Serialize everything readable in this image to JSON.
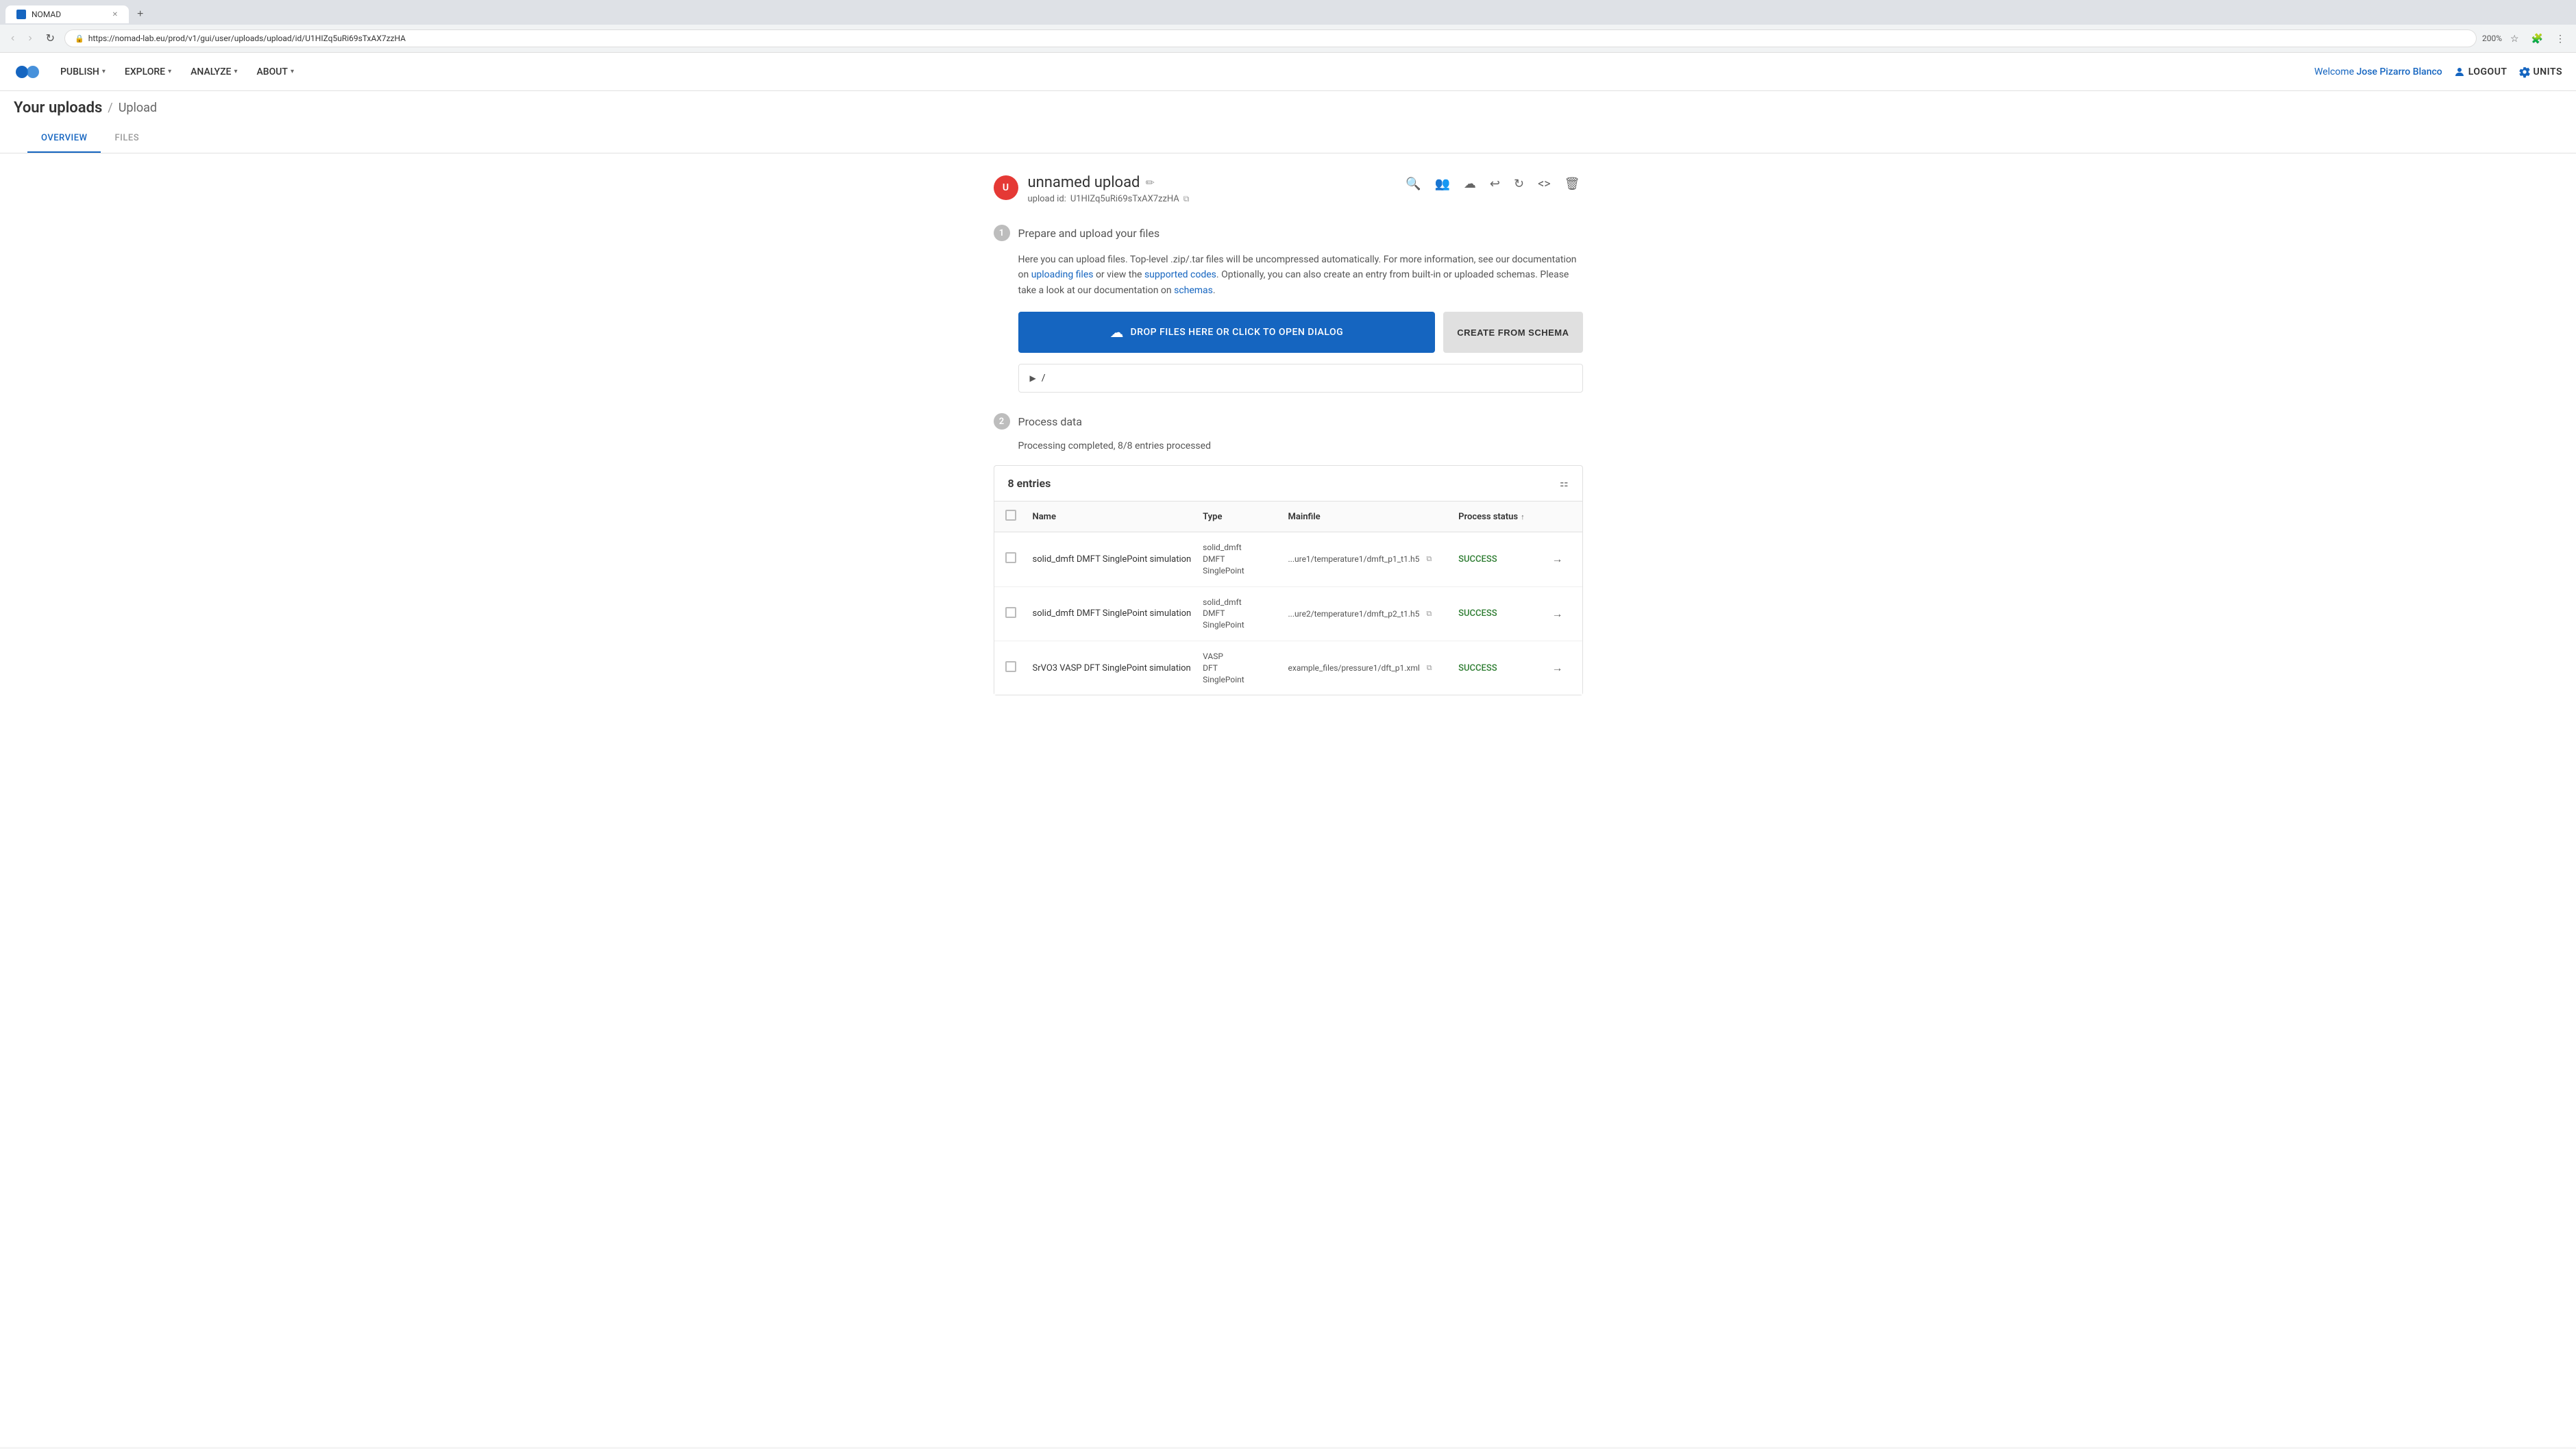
{
  "browser": {
    "tab_title": "NOMAD",
    "tab_favicon": "N",
    "url": "https://nomad-lab.eu/prod/v1/gui/user/uploads/upload/id/U1HIZq5uRi69sTxAX7zzHA",
    "zoom": "200%",
    "back_disabled": true,
    "forward_disabled": true
  },
  "nav": {
    "logo_alt": "NOMAD Logo",
    "items": [
      {
        "label": "PUBLISH",
        "has_chevron": true
      },
      {
        "label": "EXPLORE",
        "has_chevron": true
      },
      {
        "label": "ANALYZE",
        "has_chevron": true
      },
      {
        "label": "ABOUT",
        "has_chevron": true
      }
    ],
    "welcome_prefix": "Welcome ",
    "user_name": "Jose Pizarro Blanco",
    "logout_label": "LOGOUT",
    "units_label": "UNITS"
  },
  "breadcrumb": {
    "parent": "Your uploads",
    "separator": "/",
    "current": "Upload"
  },
  "tabs": [
    {
      "label": "OVERVIEW",
      "active": true
    },
    {
      "label": "FILES",
      "active": false
    }
  ],
  "upload": {
    "avatar_initials": "U",
    "title": "unnamed upload",
    "edit_icon": "✏",
    "id_label": "upload id:",
    "id_value": "U1HIZq5uRi69sTxAX7zzHA",
    "copy_icon": "⧉",
    "actions": [
      {
        "name": "search",
        "icon": "🔍"
      },
      {
        "name": "members",
        "icon": "👥"
      },
      {
        "name": "upload-cloud",
        "icon": "☁"
      },
      {
        "name": "undo",
        "icon": "↩"
      },
      {
        "name": "redo",
        "icon": "↻"
      },
      {
        "name": "code",
        "icon": "⟨⟩"
      },
      {
        "name": "delete",
        "icon": "🗑"
      }
    ]
  },
  "section1": {
    "number": "1",
    "title": "Prepare and upload your files",
    "info_text_1": "Here you can upload files. Top-level .zip/.tar files will be uncompressed automatically. For more information, see our documentation on ",
    "link1_text": "uploading files",
    "info_text_2": " or view the ",
    "link2_text": "supported codes",
    "info_text_3": ". Optionally, you can also create an entry from built-in or uploaded schemas. Please take a look at our documentation on ",
    "link3_text": "schemas",
    "info_text_4": ".",
    "drop_zone_text": "DROP FILES HERE OR CLICK TO OPEN DIALOG",
    "drop_zone_icon": "☁",
    "schema_btn_label": "CREATE FROM SCHEMA",
    "file_path": "/"
  },
  "section2": {
    "number": "2",
    "title": "Process data",
    "status_text": "Processing completed, 8/8 entries processed",
    "entries_label": "8 entries",
    "table": {
      "columns": [
        {
          "id": "name",
          "label": "Name"
        },
        {
          "id": "type",
          "label": "Type"
        },
        {
          "id": "mainfile",
          "label": "Mainfile"
        },
        {
          "id": "status",
          "label": "Process status"
        }
      ],
      "rows": [
        {
          "name": "solid_dmft DMFT SinglePoint simulation",
          "type_line1": "solid_dmft",
          "type_line2": "DMFT",
          "type_line3": "SinglePoint",
          "mainfile": "...ure1/temperature1/dmft_p1_t1.h5",
          "status": "SUCCESS"
        },
        {
          "name": "solid_dmft DMFT SinglePoint simulation",
          "type_line1": "solid_dmft",
          "type_line2": "DMFT",
          "type_line3": "SinglePoint",
          "mainfile": "...ure2/temperature1/dmft_p2_t1.h5",
          "status": "SUCCESS"
        },
        {
          "name": "SrVO3 VASP DFT SinglePoint simulation",
          "type_line1": "VASP",
          "type_line2": "DFT",
          "type_line3": "SinglePoint",
          "mainfile": "example_files/pressure1/dft_p1.xml",
          "status": "SUCCESS"
        }
      ]
    }
  }
}
